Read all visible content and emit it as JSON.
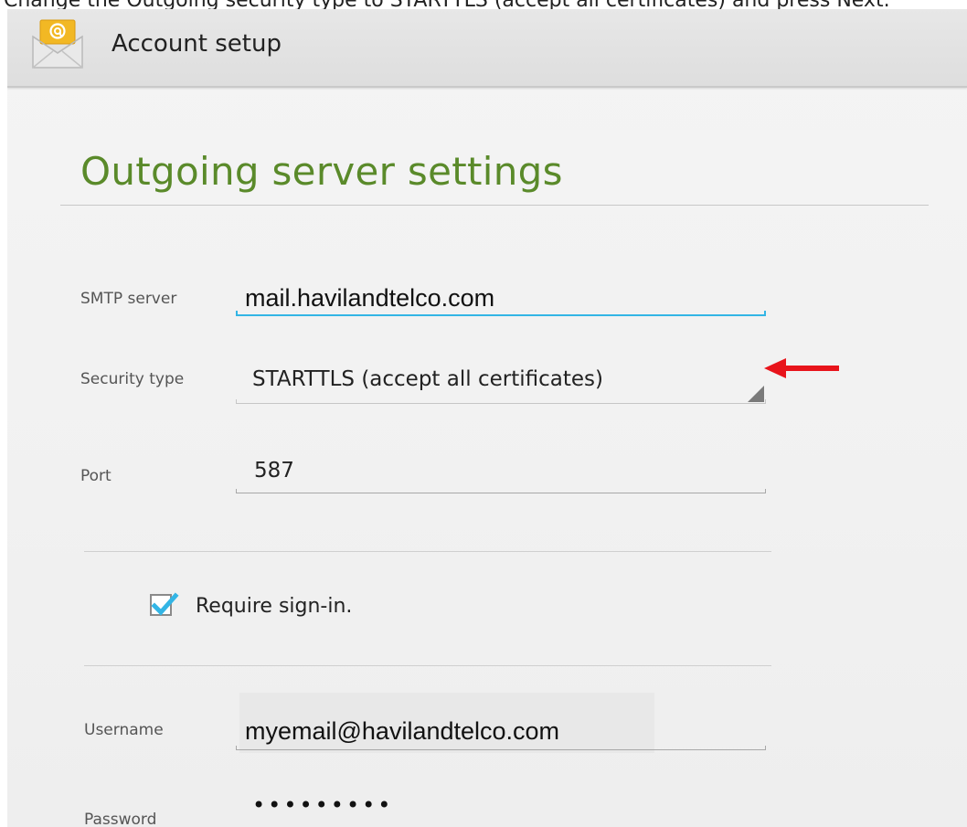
{
  "caption": {
    "text": "Change the Outgoing security type to STARTTLS (accept all certificates) and press Next."
  },
  "app": {
    "title": "Account setup",
    "icon": "email-app-icon"
  },
  "page": {
    "title": "Outgoing server settings"
  },
  "form": {
    "smtp_server": {
      "label": "SMTP server",
      "value": "mail.havilandtelco.com"
    },
    "security_type": {
      "label": "Security type",
      "value": "STARTTLS (accept all certificates)"
    },
    "port": {
      "label": "Port",
      "value": "587"
    },
    "require_signin": {
      "label": "Require sign-in.",
      "checked": true
    },
    "username": {
      "label": "Username",
      "value": "myemail@havilandtelco.com"
    },
    "password": {
      "label": "Password",
      "masked_value": "•••••••••"
    }
  },
  "colors": {
    "title_green": "#5a8a2a",
    "focus_blue": "#33b5e5",
    "checkbox_blue": "#33b5e5",
    "arrow_red": "#e8141b"
  },
  "icons": {
    "checkmark": "checkmark-icon",
    "spinner": "spinner-triangle-icon",
    "annotation_arrow": "red-arrow-icon"
  }
}
